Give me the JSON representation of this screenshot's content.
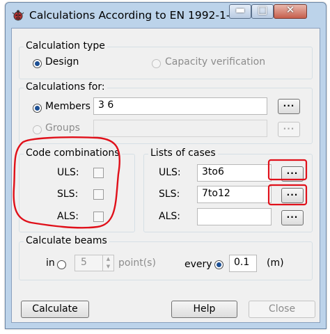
{
  "window": {
    "title": "Calculations According to EN 1992-1-1...",
    "icons": {
      "app": "ladybug-app-icon",
      "minimize": "minimize-icon",
      "maximize": "maximize-icon",
      "close": "close-icon"
    }
  },
  "calculation_type": {
    "group_label": "Calculation type",
    "options": [
      {
        "label": "Design",
        "selected": true,
        "enabled": true
      },
      {
        "label": "Capacity verification",
        "selected": false,
        "enabled": false
      }
    ]
  },
  "calculations_for": {
    "group_label": "Calculations for:",
    "members": {
      "label": "Members",
      "value": "3 6",
      "selected": true
    },
    "groups": {
      "label": "Groups",
      "value": "",
      "selected": false,
      "enabled": false
    },
    "browse_label": "..."
  },
  "code_combinations": {
    "group_label": "Code combinations",
    "items": [
      {
        "label": "ULS:",
        "checked": false
      },
      {
        "label": "SLS:",
        "checked": false
      },
      {
        "label": "ALS:",
        "checked": false
      }
    ]
  },
  "lists_of_cases": {
    "group_label": "Lists of cases",
    "items": [
      {
        "label": "ULS:",
        "value": "3to6"
      },
      {
        "label": "SLS:",
        "value": "7to12"
      },
      {
        "label": "ALS:",
        "value": ""
      }
    ],
    "browse_label": "..."
  },
  "calculate_beams": {
    "group_label": "Calculate beams",
    "in_label": "in",
    "points_value": "5",
    "points_label": "point(s)",
    "every_label": "every",
    "every_value": "0.1",
    "unit": "(m)",
    "in_selected": false,
    "every_selected": true
  },
  "buttons": {
    "calculate": "Calculate",
    "help": "Help",
    "close": "Close"
  },
  "annotation_color": "#e0101a"
}
